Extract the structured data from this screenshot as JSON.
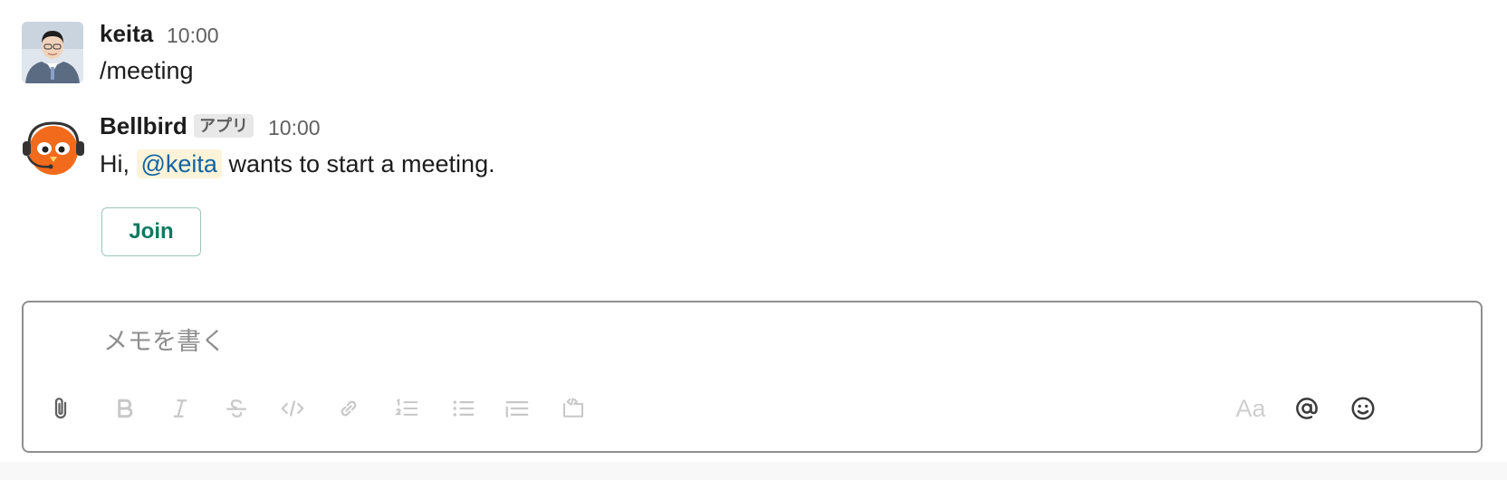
{
  "messages": [
    {
      "author": "keita",
      "time": "10:00",
      "text": "/meeting"
    },
    {
      "author": "Bellbird",
      "badge": "アプリ",
      "time": "10:00",
      "text_prefix": "Hi, ",
      "mention": "@keita",
      "text_suffix": " wants to start a meeting.",
      "button_label": "Join"
    }
  ],
  "composer": {
    "placeholder": "メモを書く",
    "toolbar_left": [
      "attach-icon",
      "bold-icon",
      "italic-icon",
      "strikethrough-icon",
      "code-icon",
      "link-icon",
      "ordered-list-icon",
      "bulleted-list-icon",
      "blockquote-icon",
      "code-block-icon"
    ],
    "format_toggle_label": "Aa",
    "toolbar_right": [
      "mention-icon",
      "emoji-icon"
    ]
  },
  "colors": {
    "join_text": "#0b7a5e",
    "mention_text": "#1264a3",
    "mention_bg": "#fcf3d8",
    "bellbird_orange": "#f26b1d"
  }
}
